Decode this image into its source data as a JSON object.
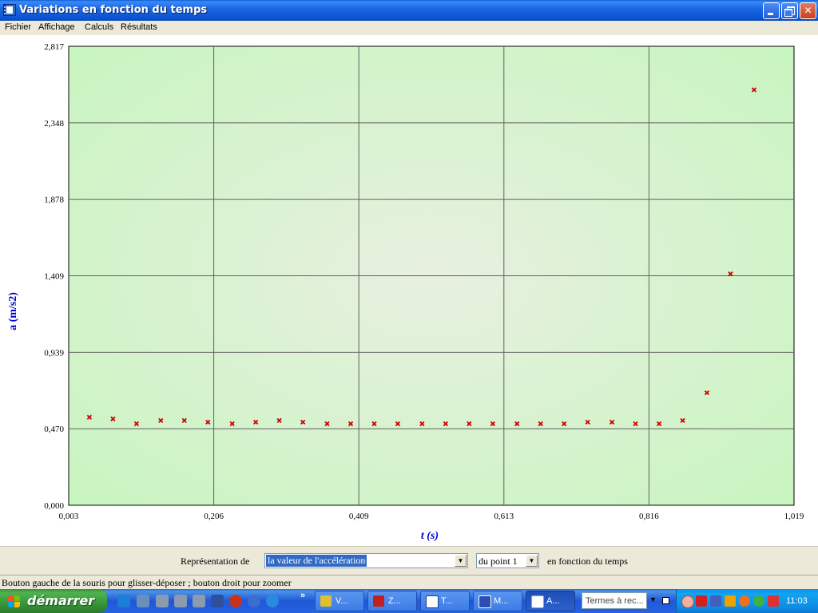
{
  "window": {
    "title": "Variations en fonction du temps"
  },
  "menu": {
    "items": [
      "Fichier",
      "Affichage",
      "Calculs",
      "Résultats"
    ]
  },
  "chart_data": {
    "type": "scatter",
    "xlabel": "t (s)",
    "ylabel": "a (m/s2)",
    "xlim": [
      0.003,
      1.019
    ],
    "ylim": [
      0.0,
      2.817
    ],
    "x_ticks": [
      "0,003",
      "0,206",
      "0,409",
      "0,613",
      "0,816",
      "1,019"
    ],
    "y_ticks": [
      "0,000",
      "0,470",
      "0,939",
      "1,409",
      "1,878",
      "2,348",
      "2,817"
    ],
    "grid": true,
    "marker": "x",
    "colors": {
      "background": "#d6f5d0",
      "grid": "#606060",
      "marker": "#cc0000",
      "axis_label": "#0000cc"
    },
    "x": [
      0.032,
      0.065,
      0.098,
      0.132,
      0.165,
      0.198,
      0.232,
      0.265,
      0.298,
      0.331,
      0.365,
      0.398,
      0.431,
      0.464,
      0.498,
      0.531,
      0.564,
      0.597,
      0.631,
      0.664,
      0.697,
      0.73,
      0.764,
      0.797,
      0.83,
      0.863,
      0.897,
      0.93,
      0.963
    ],
    "values": [
      0.54,
      0.53,
      0.5,
      0.52,
      0.52,
      0.51,
      0.5,
      0.51,
      0.52,
      0.51,
      0.5,
      0.5,
      0.5,
      0.5,
      0.5,
      0.5,
      0.5,
      0.5,
      0.5,
      0.5,
      0.5,
      0.51,
      0.51,
      0.5,
      0.5,
      0.52,
      0.69,
      1.42,
      2.55
    ]
  },
  "controls": {
    "prefix_label": "Représentation de",
    "quantity_value": "la valeur de l'accélération",
    "point_value": "du point 1",
    "suffix_label": "en fonction du temps"
  },
  "status": {
    "text": "Bouton gauche de la souris pour glisser-déposer ; bouton droit pour zoomer"
  },
  "taskbar": {
    "start_label": "démarrer",
    "tasks": [
      "V...",
      "Z...",
      "T...",
      "M...",
      "A..."
    ],
    "search_placeholder": "Termes à rec...",
    "clock": "11:03",
    "more_glyph": "»"
  }
}
